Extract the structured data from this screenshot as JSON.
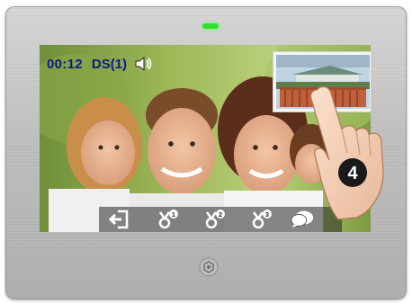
{
  "status": {
    "timer": "00:12",
    "door_station": "DS(1)",
    "speaker_icon": "speaker-icon"
  },
  "controls": [
    {
      "icon": "exit-icon"
    },
    {
      "icon": "unlock-1-icon",
      "badge": "1"
    },
    {
      "icon": "unlock-2-icon",
      "badge": "2"
    },
    {
      "icon": "unlock-3-icon",
      "badge": "3"
    },
    {
      "icon": "message-icon"
    }
  ],
  "step_badge": "4",
  "colors": {
    "led": "#2de32d",
    "status_text": "#0b1a8c",
    "control_bar": "#282828",
    "badge": "#1a1a1a"
  }
}
